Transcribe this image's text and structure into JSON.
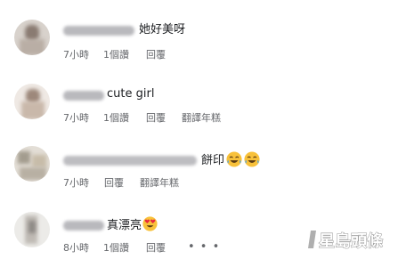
{
  "comments": [
    {
      "text": "她好美呀",
      "emoji": [],
      "time": "7小時",
      "likes": "1個讚",
      "reply_label": "回覆",
      "translate_label": ""
    },
    {
      "text": "cute girl",
      "emoji": [],
      "time": "7小時",
      "likes": "1個讚",
      "reply_label": "回覆",
      "translate_label": "翻譯年糕"
    },
    {
      "text": "餅印",
      "emoji": [
        "tears-of-joy-emoji",
        "tears-of-joy-emoji"
      ],
      "time": "7小時",
      "likes": "",
      "reply_label": "回覆",
      "translate_label": "翻譯年糕"
    },
    {
      "text": "真漂亮",
      "emoji": [
        "heart-eyes-emoji"
      ],
      "time": "8小時",
      "likes": "1個讚",
      "reply_label": "回覆",
      "more_label": "• • •"
    }
  ],
  "watermark": {
    "text": "星島頭條"
  },
  "colors": {
    "text": "#1c1e21",
    "meta": "#65676b",
    "emoji_face": "#f8c13a",
    "heart": "#e8283d"
  }
}
